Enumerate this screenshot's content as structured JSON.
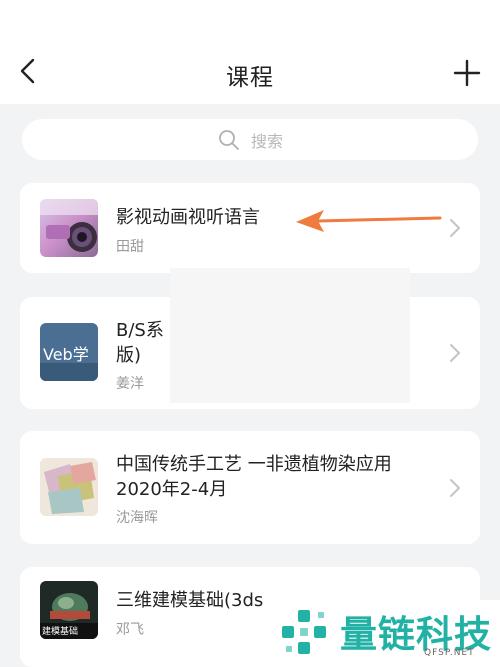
{
  "header": {
    "title": "课程"
  },
  "search": {
    "placeholder": "搜索"
  },
  "courses": [
    {
      "title": "影视动画视听语言",
      "teacher": "田甜",
      "thumb": "camera-lens-thumbnail"
    },
    {
      "title_line1": "B/S系",
      "title_line2": "版)",
      "teacher": "姜洋",
      "thumb": "web-course-thumbnail",
      "thumb_text": "Veb学"
    },
    {
      "title": "中国传统手工艺 一非遗植物染应用2020年2-4月",
      "teacher": "沈海晖",
      "thumb": "dyed-fabric-thumbnail"
    },
    {
      "title": "三维建模基础(3ds",
      "teacher": "邓飞",
      "thumb": "3d-modeling-thumbnail",
      "thumb_text": "建模基础"
    }
  ],
  "watermark": {
    "name": "量链科技",
    "url": "QFSP.NET"
  },
  "colors": {
    "accent_arrow": "#f07b3f",
    "watermark": "#22b2a5",
    "background": "#f2f3f5"
  }
}
